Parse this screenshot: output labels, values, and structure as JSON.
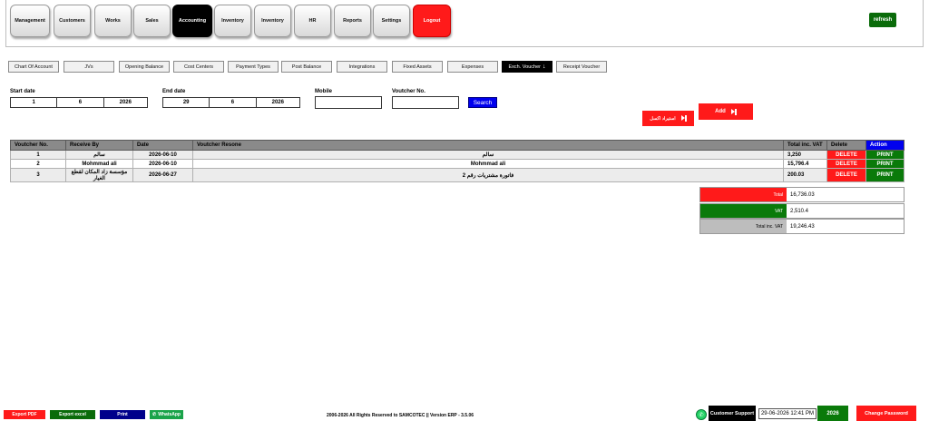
{
  "nav": {
    "items": [
      "Management",
      "Customers",
      "Works",
      "Sales",
      "Accounting",
      "Inventory",
      "Inventory",
      "HR",
      "Reports",
      "Settings",
      "Logout"
    ],
    "active": "Accounting",
    "refresh": "refresh"
  },
  "subnav": {
    "items": [
      "Chart Of Account",
      "JVs",
      "Opening Balance",
      "Cost Centers",
      "Payment Types",
      "Post Balance",
      "Integrations",
      "Fixed Assets",
      "Expenses",
      "Exch. Voucher",
      "Receipt Voucher"
    ],
    "active": "Exch. Voucher",
    "active_icon": "down-arrow-icon"
  },
  "filters": {
    "start_label": "Start date",
    "start": {
      "day": "1",
      "month": "6",
      "year": "2026"
    },
    "end_label": "End date",
    "end": {
      "day": "29",
      "month": "6",
      "year": "2026"
    },
    "mobile_label": "Mobile",
    "mobile_value": "",
    "voucher_label": "Voutcher No.",
    "voucher_value": "",
    "search": "Search"
  },
  "actions": {
    "add": "Add",
    "import": "استيراد اكسل"
  },
  "table": {
    "headers": [
      "Voutcher No.",
      "Receive By",
      "Date",
      "Voutcher Resone",
      "Total inc. VAT",
      "Delete",
      "Action"
    ],
    "rows": [
      {
        "no": "1",
        "receive_by": "سالم",
        "date": "2026-06-10",
        "reason": "سالم",
        "total": "3,250",
        "delete": "DELETE",
        "action": "PRINT"
      },
      {
        "no": "2",
        "receive_by": "Mohmmad ali",
        "date": "2026-06-10",
        "reason": "Mohmmad ali",
        "total": "15,796.4",
        "delete": "DELETE",
        "action": "PRINT"
      },
      {
        "no": "3",
        "receive_by": "مؤسسة زاد المكان لقطع الغيار",
        "date": "2026-06-27",
        "reason": "فاتورة مشتريات رقم 2",
        "total": "200.03",
        "delete": "DELETE",
        "action": "PRINT"
      }
    ]
  },
  "totals": {
    "total_label": "Total",
    "total_value": "16,736.03",
    "vat_label": "VAT",
    "vat_value": "2,510.4",
    "inc_label": "Total inc. VAT",
    "inc_value": "19,246.43"
  },
  "footer": {
    "export_pdf": "Export PDF",
    "export_excel": "Export excel",
    "print": "Print",
    "whatsapp": "WhatsApp",
    "copyright": "2006-2026 All Rights Reserved to SAMCOTEC || Version ERP - 3.5.06",
    "support": "Customer Support",
    "datetime": "29-06-2026 12:41 PM",
    "year": "2026",
    "change_password": "Change Password"
  },
  "colors": {
    "red": "#ff1a1a",
    "green": "#0a7a0a",
    "blue": "#0000ee",
    "gray": "#8a8a8a"
  }
}
